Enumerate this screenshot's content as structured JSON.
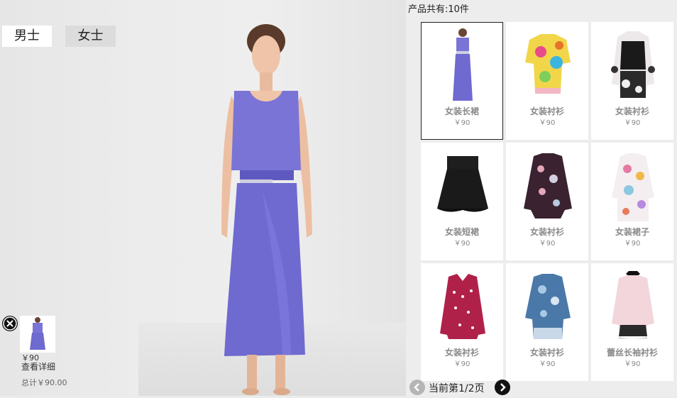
{
  "gender_tabs": {
    "men": "男士",
    "women": "女士"
  },
  "products_header": "产品共有:10件",
  "products": [
    {
      "name": "女装长裙",
      "price": "￥90",
      "icon": "purple-long-dress",
      "selected": true
    },
    {
      "name": "女装衬衫",
      "price": "￥90",
      "icon": "colorful-print-shirt"
    },
    {
      "name": "女装衬衫",
      "price": "￥90",
      "icon": "black-floral-blouse"
    },
    {
      "name": "女装短裙",
      "price": "￥90",
      "icon": "black-flared-skirt"
    },
    {
      "name": "女装衬衫",
      "price": "￥90",
      "icon": "floral-longsleeve-shirt"
    },
    {
      "name": "女装裙子",
      "price": "￥90",
      "icon": "floral-dress"
    },
    {
      "name": "女装衬衫",
      "price": "￥90",
      "icon": "red-polka-dot-shirt"
    },
    {
      "name": "女装衬衫",
      "price": "￥90",
      "icon": "blue-print-shirt"
    },
    {
      "name": "蕾丝长袖衬衫",
      "price": "￥90",
      "icon": "pink-lace-longsleeve-shirt"
    }
  ],
  "pagination": {
    "text": "当前第1/2页"
  },
  "cart": {
    "item_price": "￥90",
    "detail_link": "查看详细",
    "total": "总计￥90.00"
  },
  "colors": {
    "dress": "#6e6ad0",
    "skin": "#efc4a8",
    "background": "#ececec"
  }
}
